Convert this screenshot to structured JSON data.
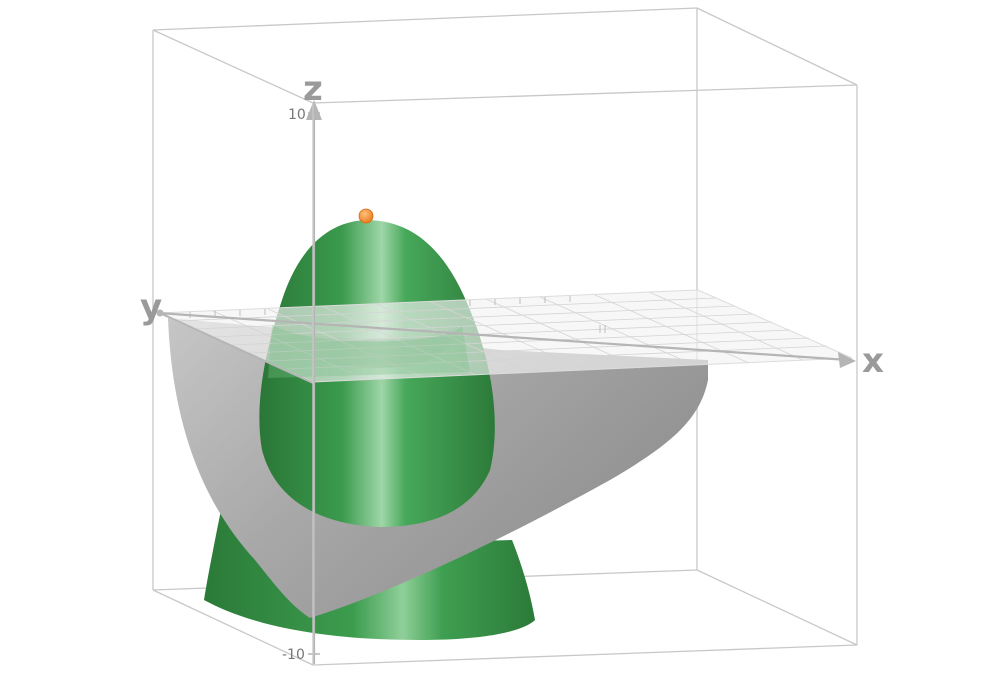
{
  "axes": {
    "x_label": "x",
    "y_label": "y",
    "z_label": "z",
    "z_max_tick": "10",
    "z_min_tick": "-10"
  },
  "colors": {
    "surface_green": "#3f9a50",
    "surface_gray": "#a9a9a9",
    "plane": "#f4f4f4",
    "box": "#c8c8c8",
    "point": "#f08a2a"
  }
}
